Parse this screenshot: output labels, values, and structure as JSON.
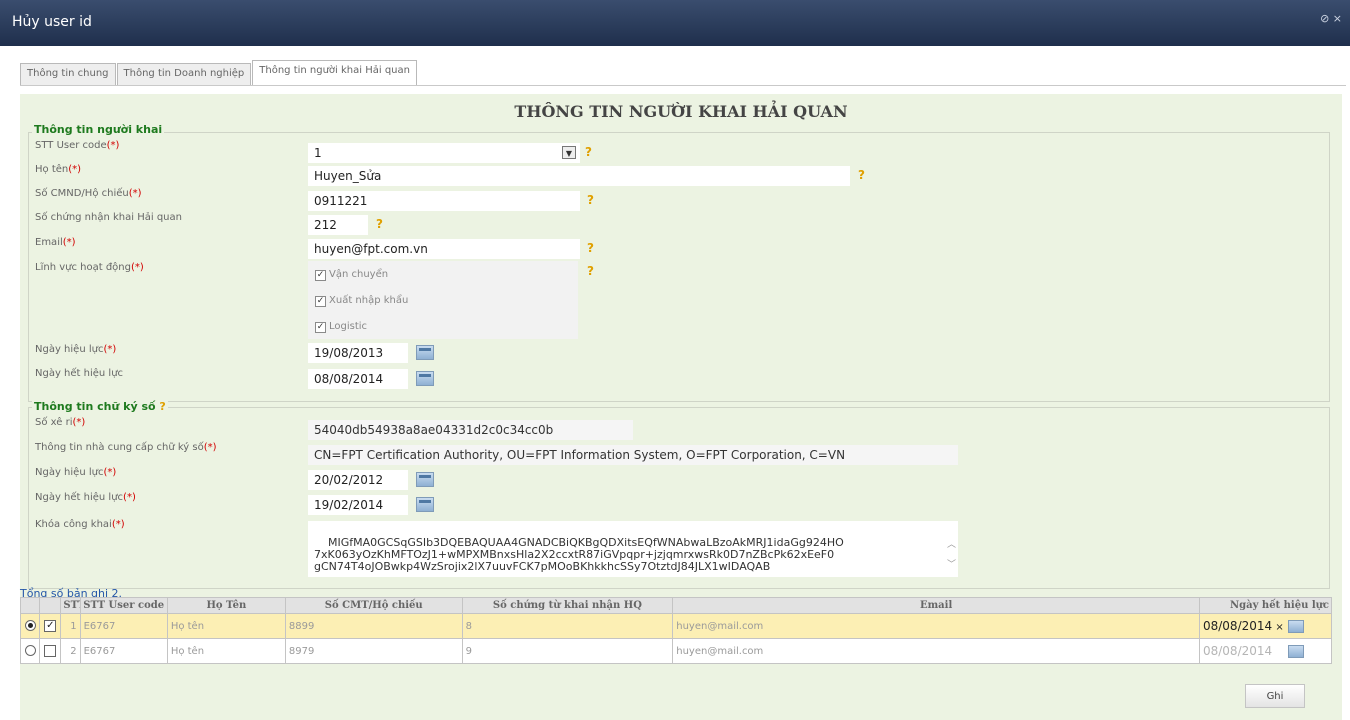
{
  "window": {
    "title": "Hủy user id",
    "controls": "⊘ ×"
  },
  "tabs": [
    {
      "label": "Thông tin chung"
    },
    {
      "label": "Thông tin Doanh nghiệp"
    },
    {
      "label": "Thông tin người khai Hải quan"
    }
  ],
  "heading": "THÔNG TIN NGƯỜI KHAI HẢI QUAN",
  "declarant": {
    "legend": "Thông tin người khai",
    "required_mark": "(*)",
    "help": "?",
    "stt_user_code": {
      "label": "STT User code",
      "value": "1"
    },
    "full_name": {
      "label": "Họ tên",
      "value": "Huyen_Sửa"
    },
    "id_number": {
      "label": "Số CMND/Hộ chiếu",
      "value": "0911221"
    },
    "cert_number": {
      "label": "Số chứng nhận khai Hải quan",
      "value": "212"
    },
    "email": {
      "label": "Email",
      "value": "huyen@fpt.com.vn"
    },
    "field_of_activity": {
      "label": "Lĩnh vực hoạt động",
      "options": [
        {
          "label": "Vận chuyển",
          "checked": true
        },
        {
          "label": "Xuất nhập khẩu",
          "checked": true
        },
        {
          "label": "Logistic",
          "checked": true
        }
      ]
    },
    "effective_date": {
      "label": "Ngày hiệu lực",
      "value": "19/08/2013"
    },
    "expiry_date": {
      "label": "Ngày hết hiệu lực",
      "value": "08/08/2014"
    }
  },
  "signature": {
    "legend": "Thông tin chữ ký số",
    "serial": {
      "label": "Số xê ri",
      "value": "54040db54938a8ae04331d2c0c34cc0b"
    },
    "provider": {
      "label": "Thông tin nhà cung cấp chữ ký số",
      "value": "CN=FPT Certification Authority, OU=FPT Information System, O=FPT Corporation, C=VN"
    },
    "effective_date": {
      "label": "Ngày hiệu lực",
      "value": "20/02/2012"
    },
    "expiry_date": {
      "label": "Ngày hết hiệu lực",
      "value": "19/02/2014"
    },
    "public_key": {
      "label": "Khóa công khai",
      "value": "MIGfMA0GCSqGSIb3DQEBAQUAA4GNADCBiQKBgQDXitsEQfWNAbwaLBzoAkMRJ1idaGg924HO\n7xK063yOzKhMFTOzJ1+wMPXMBnxsHla2X2ccxtR87iGVpqpr+jzjqmrxwsRk0D7nZBcPk62xEeF0\ngCN74T4oJOBwkp4WzSrojix2lX7uuvFCK7pMOoBKhkkhcSSy7OtztdJ84JLX1wIDAQAB"
    }
  },
  "grid": {
    "total": "Tổng số bản ghi 2.",
    "columns": [
      "",
      "",
      "STT",
      "STT User code",
      "Họ Tên",
      "Số CMT/Hộ chiếu",
      "Số chứng từ khai nhận HQ",
      "Email",
      "Ngày hết hiệu lực"
    ],
    "rows": [
      {
        "selected": true,
        "checked": true,
        "stt": "1",
        "user_code": "E6767",
        "name": "Họ tên",
        "id": "8899",
        "doc": "8",
        "email": "huyen@mail.com",
        "expiry": "08/08/2014",
        "clear": "×"
      },
      {
        "selected": false,
        "checked": false,
        "stt": "2",
        "user_code": "E6767",
        "name": "Họ tên",
        "id": "8979",
        "doc": "9",
        "email": "huyen@mail.com",
        "expiry": "08/08/2014",
        "clear": ""
      }
    ]
  },
  "actions": {
    "save_label": "Ghi"
  },
  "colors": {
    "titlebar": "#2a3a58",
    "panel_bg": "#ecf3e2",
    "legend_green": "#1e7a1e",
    "required_red": "#d20000",
    "selected_row": "#fcefb4"
  }
}
